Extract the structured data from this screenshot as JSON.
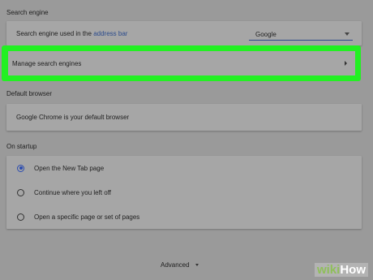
{
  "search_engine": {
    "section_title": "Search engine",
    "used_label_prefix": "Search engine used in the",
    "used_label_link": "address bar",
    "selected_engine": "Google",
    "manage_label": "Manage search engines"
  },
  "default_browser": {
    "section_title": "Default browser",
    "status": "Google Chrome is your default browser"
  },
  "startup": {
    "section_title": "On startup",
    "options": [
      {
        "label": "Open the New Tab page",
        "selected": true
      },
      {
        "label": "Continue where you left off",
        "selected": false
      },
      {
        "label": "Open a specific page or set of pages",
        "selected": false
      }
    ]
  },
  "advanced": {
    "label": "Advanced"
  },
  "watermark": {
    "part1": "wiki",
    "part2": "How"
  },
  "colors": {
    "highlight": "#22f022",
    "accent": "#2b4bb0",
    "background": "#9a9a9a"
  }
}
